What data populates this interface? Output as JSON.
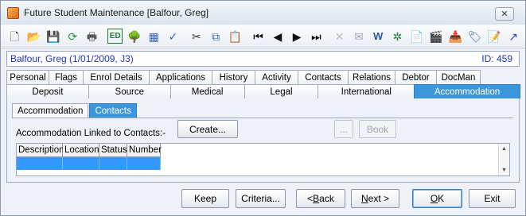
{
  "window": {
    "title": "Future Student Maintenance  [Balfour, Greg]"
  },
  "toolbar": {
    "buttons": [
      {
        "name": "new-document-icon",
        "glyph": "🗋",
        "color": "#333"
      },
      {
        "name": "open-folder-icon",
        "glyph": "📂",
        "color": "#d9a020"
      },
      {
        "name": "save-icon",
        "glyph": "💾",
        "color": "#9aa4b2"
      },
      {
        "name": "refresh-icon",
        "glyph": "⟳",
        "color": "#1f9a3a"
      },
      {
        "name": "print-icon",
        "glyph": "🖶",
        "color": "#555"
      },
      {
        "name": "edit-field-icon",
        "glyph": "ED",
        "color": "#1d7a2e"
      },
      {
        "name": "tree-icon",
        "glyph": "🌳",
        "color": "#2d8a2d"
      },
      {
        "name": "calculator-icon",
        "glyph": "▦",
        "color": "#3a64b0"
      },
      {
        "name": "spellcheck-icon",
        "glyph": "✓",
        "color": "#2a63c4"
      },
      {
        "name": "cut-icon",
        "glyph": "✂",
        "color": "#333"
      },
      {
        "name": "copy-icon",
        "glyph": "⧉",
        "color": "#3a64b0"
      },
      {
        "name": "paste-icon",
        "glyph": "📋",
        "color": "#b88a2a"
      },
      {
        "name": "first-record-icon",
        "glyph": "⏮",
        "color": "#111"
      },
      {
        "name": "previous-record-icon",
        "glyph": "◀",
        "color": "#111"
      },
      {
        "name": "next-record-icon",
        "glyph": "▶",
        "color": "#111"
      },
      {
        "name": "last-record-icon",
        "glyph": "⏭",
        "color": "#111"
      },
      {
        "name": "delete-icon",
        "glyph": "✕",
        "color": "#b8bec7"
      },
      {
        "name": "email-icon",
        "glyph": "✉",
        "color": "#9aa4b2"
      },
      {
        "name": "word-icon",
        "glyph": "W",
        "color": "#2b579a"
      },
      {
        "name": "excel-icon",
        "glyph": "✲",
        "color": "#1f7a35"
      },
      {
        "name": "clipboard-icon",
        "glyph": "📄",
        "color": "#c9922a"
      },
      {
        "name": "clapperboard-icon",
        "glyph": "🎬",
        "color": "#333"
      },
      {
        "name": "inbox-icon",
        "glyph": "📥",
        "color": "#c23a2a"
      },
      {
        "name": "tag-icon",
        "glyph": "🏷",
        "color": "#3a64b0"
      },
      {
        "name": "notebook-edit-icon",
        "glyph": "📝",
        "color": "#2f6bd0"
      },
      {
        "name": "pointer-arrow-icon",
        "glyph": "↗",
        "color": "#2b3fc4"
      }
    ]
  },
  "student": {
    "name": "Balfour, Greg (1/01/2009, J3)",
    "id": "ID: 459"
  },
  "tabs": {
    "row1": [
      "Personal",
      "Flags",
      "Enrol Details",
      "Applications",
      "History",
      "Activity",
      "Contacts",
      "Relations",
      "Debtor",
      "DocMan"
    ],
    "row2": [
      "Deposit",
      "Source",
      "Medical",
      "Legal",
      "International",
      "Accommodation"
    ],
    "active": "Accommodation"
  },
  "subtabs": {
    "items": [
      "Accommodation",
      "Contacts"
    ],
    "active": "Contacts"
  },
  "contacts_panel": {
    "label": "Accommodation Linked to Contacts:-",
    "create_button": "Create...",
    "ellipsis_button": "...",
    "book_button": "Book",
    "columns": [
      "Description",
      "Location",
      "Status",
      "Number"
    ]
  },
  "footer": {
    "keep": "Keep",
    "criteria": "Criteria...",
    "back_pre": "< ",
    "back_key": "B",
    "back_post": "ack",
    "next_pre": "",
    "next_key": "N",
    "next_post": "ext >",
    "ok_key": "O",
    "ok_post": "K",
    "exit": "Exit"
  },
  "colors": {
    "accent": "#3a96dd",
    "selection": "#3399ff",
    "student_text": "#1f33b8"
  }
}
